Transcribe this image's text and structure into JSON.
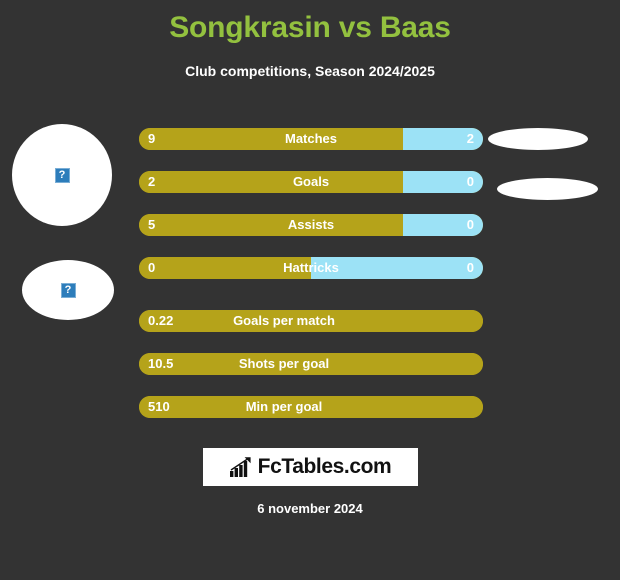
{
  "header": {
    "title": "Songkrasin vs Baas",
    "subtitle": "Club competitions, Season 2024/2025",
    "title_color": "#93c13f",
    "subtitle_color": "#ffffff"
  },
  "theme": {
    "background": "#333333",
    "home_bar_color": "#b5a31a",
    "away_bar_color": "#9ce2f6",
    "text_color": "#ffffff"
  },
  "avatars": {
    "home": {
      "placeholder_glyph": "?",
      "alt": "broken-image"
    },
    "away": {
      "placeholder_glyph": "?",
      "alt": "broken-image"
    }
  },
  "stats": [
    {
      "label": "Matches",
      "home": "9",
      "away": "2",
      "home_pct": 76.7,
      "away_pct": 23.3,
      "has_away": true
    },
    {
      "label": "Goals",
      "home": "2",
      "away": "0",
      "home_pct": 76.7,
      "away_pct": 23.3,
      "has_away": true
    },
    {
      "label": "Assists",
      "home": "5",
      "away": "0",
      "home_pct": 76.7,
      "away_pct": 23.3,
      "has_away": true
    },
    {
      "label": "Hattricks",
      "home": "0",
      "away": "0",
      "home_pct": 50.0,
      "away_pct": 50.0,
      "has_away": true
    },
    {
      "label": "Goals per match",
      "home": "0.22",
      "away": "",
      "home_pct": 100,
      "away_pct": 0,
      "has_away": false
    },
    {
      "label": "Shots per goal",
      "home": "10.5",
      "away": "",
      "home_pct": 100,
      "away_pct": 0,
      "has_away": false
    },
    {
      "label": "Min per goal",
      "home": "510",
      "away": "",
      "home_pct": 100,
      "away_pct": 0,
      "has_away": false
    }
  ],
  "logo": {
    "text": "FcTables.com",
    "icon": "bar-chart-icon"
  },
  "footer": {
    "date": "6 november 2024"
  }
}
